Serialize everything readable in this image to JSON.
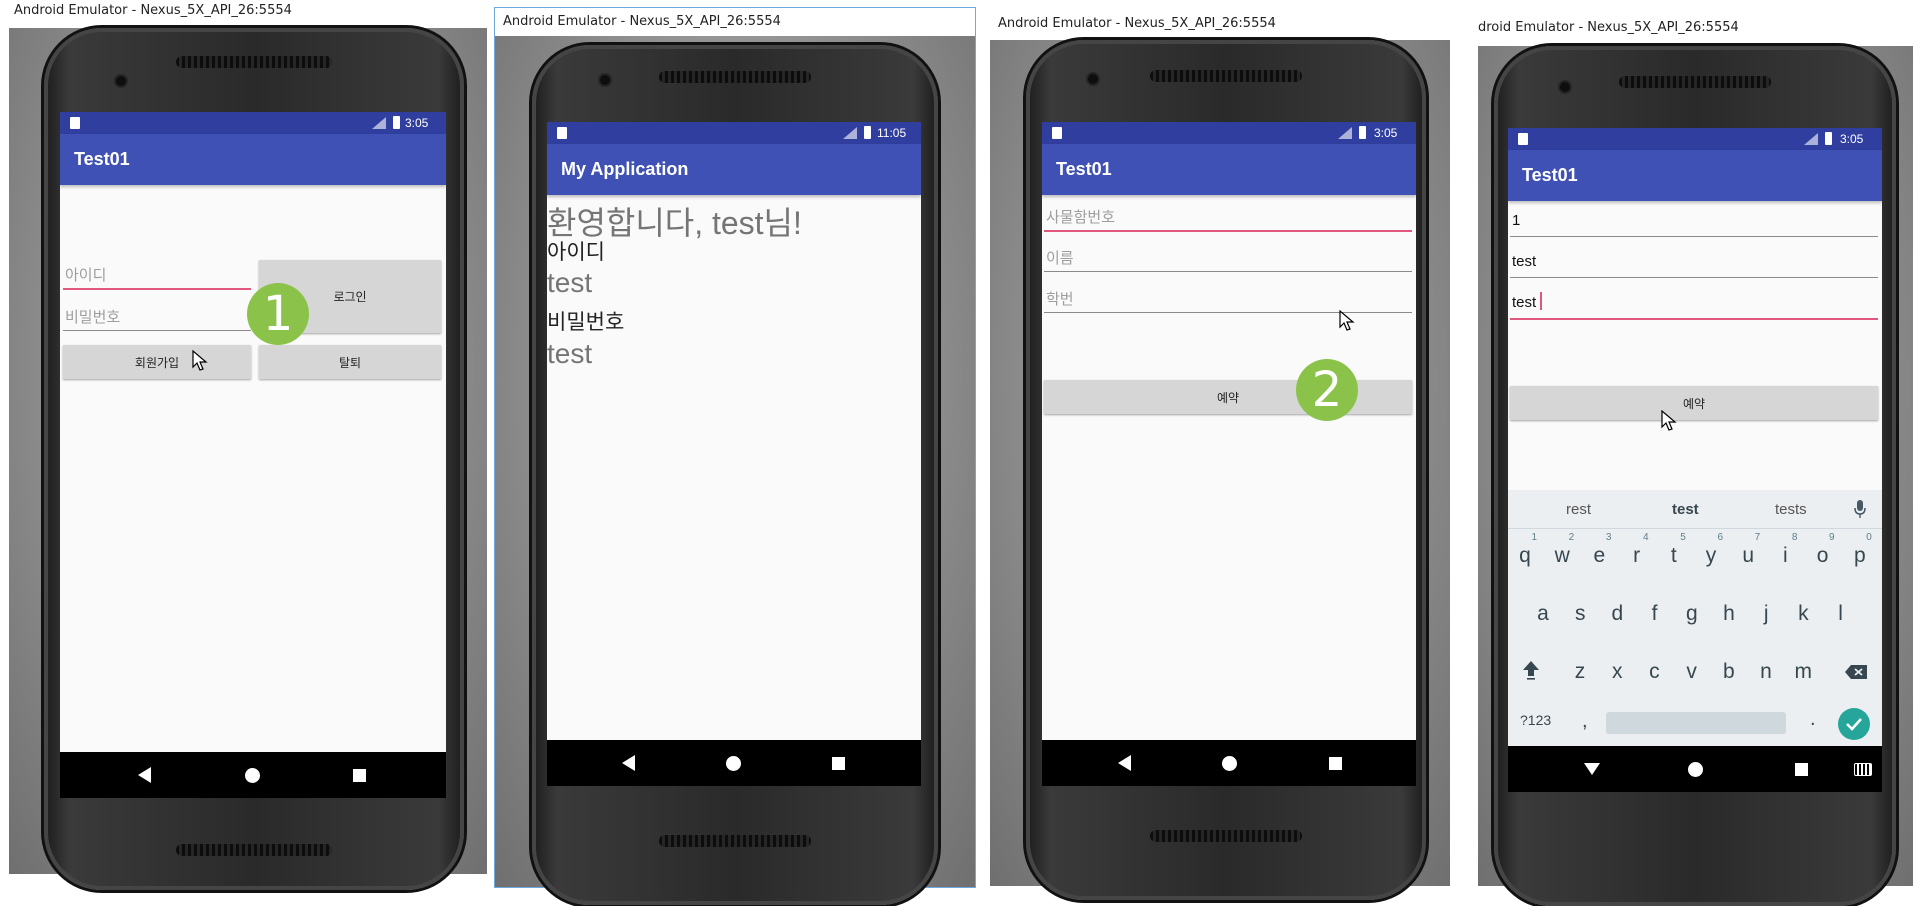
{
  "windows": [
    {
      "title": "Android Emulator - Nexus_5X_API_26:5554",
      "status_time": "3:05",
      "app_title": "Test01",
      "id_placeholder": "아이디",
      "pw_placeholder": "비밀번호",
      "login_button": "로그인",
      "signup_button": "회원가입",
      "withdraw_button": "탈퇴",
      "step_badge": "1"
    },
    {
      "title": "Android Emulator - Nexus_5X_API_26:5554",
      "status_time": "11:05",
      "app_title": "My Application",
      "welcome_text": "환영합니다, test님!",
      "id_label": "아이디",
      "id_value": "test",
      "pw_label": "비밀번호",
      "pw_value": "test"
    },
    {
      "title": "Android Emulator - Nexus_5X_API_26:5554",
      "status_time": "3:05",
      "app_title": "Test01",
      "locker_placeholder": "사물함번호",
      "name_placeholder": "이름",
      "student_id_placeholder": "학번",
      "reserve_button": "예약",
      "step_badge": "2"
    },
    {
      "title": "droid Emulator - Nexus_5X_API_26:5554",
      "status_time": "3:05",
      "app_title": "Test01",
      "locker_value": "1",
      "name_value": "test",
      "student_id_value": "test",
      "reserve_button": "예약",
      "suggestions": [
        "rest",
        "test",
        "tests"
      ],
      "keyboard": {
        "row1": [
          [
            "q",
            "1"
          ],
          [
            "w",
            "2"
          ],
          [
            "e",
            "3"
          ],
          [
            "r",
            "4"
          ],
          [
            "t",
            "5"
          ],
          [
            "y",
            "6"
          ],
          [
            "u",
            "7"
          ],
          [
            "i",
            "8"
          ],
          [
            "o",
            "9"
          ],
          [
            "p",
            "0"
          ]
        ],
        "row2": [
          "a",
          "s",
          "d",
          "f",
          "g",
          "h",
          "j",
          "k",
          "l"
        ],
        "row3": [
          "z",
          "x",
          "c",
          "v",
          "b",
          "n",
          "m"
        ],
        "symbols_key": "?123",
        "comma_key": ",",
        "period_key": "."
      }
    }
  ],
  "colors": {
    "status_bar": "#303f9f",
    "app_bar": "#3f51b5",
    "accent": "#e0567c",
    "badge": "#8bc34a",
    "keyboard_enter": "#26a69a"
  }
}
